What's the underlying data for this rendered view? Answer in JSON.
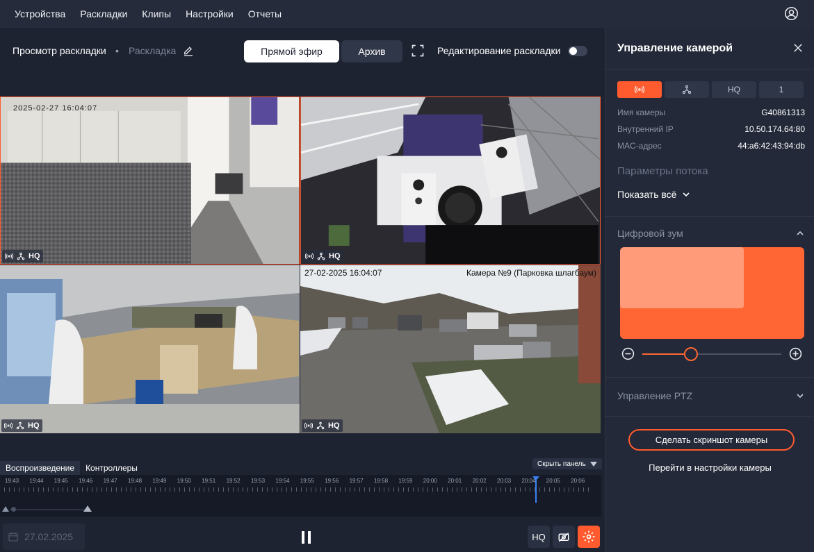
{
  "nav": {
    "items": [
      "Устройства",
      "Раскладки",
      "Клипы",
      "Настройки",
      "Отчеты"
    ]
  },
  "toolbar": {
    "breadcrumb_main": "Просмотр раскладки",
    "breadcrumb_sep": "•",
    "breadcrumb_layout": "Раскладка",
    "live_label": "Прямой эфир",
    "archive_label": "Архив",
    "edit_layout_label": "Редактирование раскладки",
    "edit_layout_enabled": false
  },
  "tiles": [
    {
      "badge_hq": "HQ",
      "overlay_timestamp": "2025-02-27 16:04:07",
      "overlay_name": ""
    },
    {
      "badge_hq": "HQ",
      "overlay_timestamp": "",
      "overlay_name": ""
    },
    {
      "badge_hq": "HQ",
      "overlay_timestamp": "",
      "overlay_name": ""
    },
    {
      "badge_hq": "HQ",
      "overlay_timestamp": "27-02-2025 16:04:07",
      "overlay_name": "Камера №9 (Парковка шлагбаум)"
    }
  ],
  "bottom_panel": {
    "tabs": [
      "Воспроизведение",
      "Контроллеры"
    ],
    "active_tab": "Воспроизведение",
    "hide_panel_label": "Скрыть панель",
    "timeline_labels": [
      "19:43",
      "19:44",
      "19:45",
      "19:46",
      "19:47",
      "19:48",
      "19:49",
      "19:50",
      "19:51",
      "19:52",
      "19:53",
      "19:54",
      "19:55",
      "19:56",
      "19:57",
      "19:58",
      "19:59",
      "20:00",
      "20:01",
      "20:02",
      "20:03",
      "20:04",
      "20:05",
      "20:06"
    ],
    "date_value": "27.02.2025",
    "hq_label": "HQ"
  },
  "side": {
    "title": "Управление камерой",
    "segments": [
      "live-icon",
      "network-icon",
      "HQ",
      "1"
    ],
    "info": [
      {
        "key": "Имя камеры",
        "value": "G40861313"
      },
      {
        "key": "Внутренний IP",
        "value": "10.50.174.64:80"
      },
      {
        "key": "MAC-адрес",
        "value": "44:a6:42:43:94:db"
      }
    ],
    "stream_params_title": "Параметры потока",
    "show_all_label": "Показать всё",
    "digital_zoom_title": "Цифровой зум",
    "zoom_level": 0.35,
    "ptz_title": "Управление PTZ",
    "screenshot_button": "Сделать скриншот камеры",
    "settings_link": "Перейти в настройки камеры"
  },
  "colors": {
    "accent": "#ff5b2e",
    "background": "#1c2130",
    "panel": "#232938"
  }
}
